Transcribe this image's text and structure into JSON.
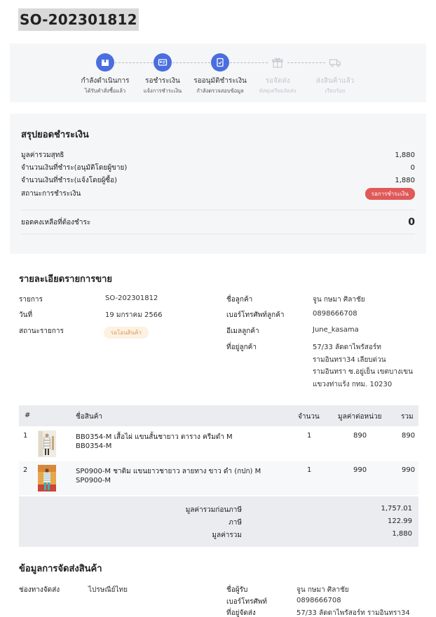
{
  "order": {
    "id": "SO-202301812"
  },
  "progress": {
    "steps": [
      {
        "label": "กำลังดำเนินการ",
        "sub": "ได้รับคำสั่งซื้อแล้ว",
        "icon": "box-icon",
        "active": true
      },
      {
        "label": "รอชำระเงิน",
        "sub": "แจ้งการชำระเงิน",
        "icon": "card-icon",
        "active": true
      },
      {
        "label": "รออนุมัติชำระเงิน",
        "sub": "กำลังตรวจสอบข้อมูล",
        "icon": "document-check-icon",
        "active": true
      },
      {
        "label": "รอจัดส่ง",
        "sub": "พัสดุเตรียมจัดส่ง",
        "icon": "gift-icon",
        "active": false
      },
      {
        "label": "ส่งสินค้าแล้ว",
        "sub": "เรียบร้อย",
        "icon": "truck-icon",
        "active": false
      }
    ]
  },
  "summary": {
    "title": "สรุปยอดชำระเงิน",
    "rows": [
      {
        "label": "มูลค่ารวมสุทธิ",
        "value": "1,880"
      },
      {
        "label": "จำนวนเงินที่ชำระ(อนุมัติโดยผู้ขาย)",
        "value": "0"
      },
      {
        "label": "จำนวนเงินที่ชำระ(แจ้งโดยผู้ซื้อ)",
        "value": "1,880"
      }
    ],
    "status_label": "สถานะการชำระเงิน",
    "status_badge": "รอการชำระเงิน",
    "balance_label": "ยอดคงเหลือที่ต้องชำระ",
    "balance_value": "0"
  },
  "details": {
    "title": "รายละเอียดรายการขาย",
    "order_label": "รายการ",
    "order_value": "SO-202301812",
    "date_label": "วันที่",
    "date_value": "19 มกราคม 2566",
    "status_label": "สถานะรายการ",
    "status_badge": "รอโอนสินค้า",
    "customer_name_label": "ชื่อลูกค้า",
    "customer_name_value": "จูน กษมา ศิลาชัย",
    "phone_label": "เบอร์โทรศัพท์ลูกค้า",
    "phone_value": "0898666708",
    "email_label": "อีเมลลูกค้า",
    "email_value": "June_kasama",
    "address_label": "ที่อยู่ลูกค้า",
    "address_lines": [
      "57/33 ลัดดาไพรัสอร์ท",
      "รามอินทรา34 เลียบด่วน",
      "รามอินทรา ซ.อยู่เย็น เขตบางเขน",
      "แขวงท่าแร้ง กทม. 10230"
    ]
  },
  "items": {
    "headers": {
      "num": "#",
      "name": "ชื่อสินค้า",
      "qty": "จำนวน",
      "unit_price": "มูลค่าต่อหน่วย",
      "total": "รวม"
    },
    "rows": [
      {
        "num": "1",
        "name": "BB0354-M เสื้อไผ่ แขนสั้นชายาว ตาราง ครีมดำ M",
        "sku": "BB0354-M",
        "qty": "1",
        "unit_price": "890",
        "total": "890"
      },
      {
        "num": "2",
        "name": "SP0900-M ชาติม แขนยาวชายาว ลายทาง ขาว ดำ (กปก) M",
        "sku": "SP0900-M",
        "qty": "1",
        "unit_price": "990",
        "total": "990"
      }
    ],
    "totals": [
      {
        "label": "มูลค่ารวมก่อนภาษี",
        "value": "1,757.01"
      },
      {
        "label": "ภาษี",
        "value": "122.99"
      },
      {
        "label": "มูลค่ารวม",
        "value": "1,880"
      }
    ]
  },
  "shipping": {
    "title": "ข้อมูลการจัดส่งสินค้า",
    "channel_label": "ช่องทางจัดส่ง",
    "channel_value": "ไปรษณีย์ไทย",
    "recipient_label": "ชื่อผู้รับ",
    "recipient_value": "จูน กษมา ศิลาชัย",
    "phone_label": "เบอร์โทรศัพท์",
    "phone_value": "0898666708",
    "address_label": "ที่อยู่จัดส่ง",
    "address_value": "57/33 ลัดดาไพรัสอร์ท รามอินทรา34"
  },
  "colors": {
    "accent": "#4a6ee0",
    "badge_red": "#e05a5a",
    "badge_peach": "#fdf1e2",
    "panel": "#f5f6f7"
  }
}
